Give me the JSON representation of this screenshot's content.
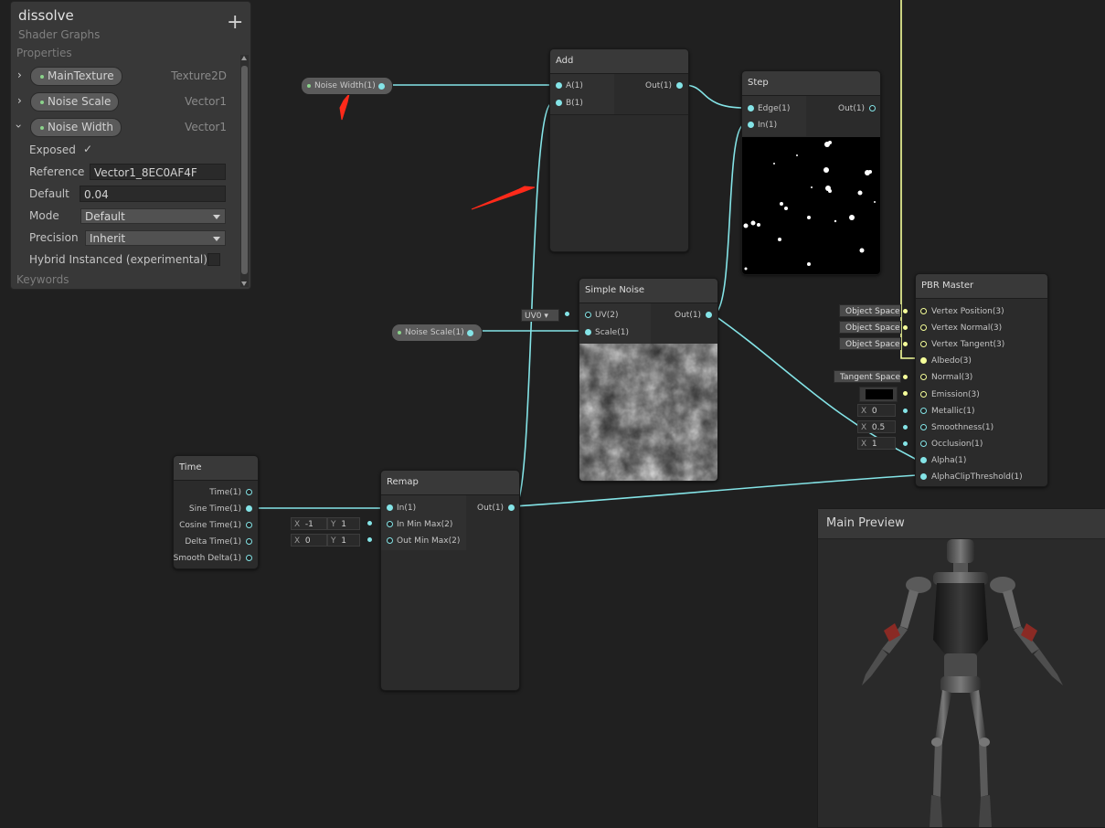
{
  "blackboard": {
    "title": "dissolve",
    "subtitle": "Shader Graphs",
    "add_label": "+",
    "properties_label": "Properties",
    "properties": [
      {
        "name": "MainTexture",
        "type": "Texture2D"
      },
      {
        "name": "Noise Scale",
        "type": "Vector1"
      },
      {
        "name": "Noise Width",
        "type": "Vector1"
      }
    ],
    "settings": {
      "exposed_label": "Exposed",
      "exposed_check": "✓",
      "reference_label": "Reference",
      "reference_value": "Vector1_8EC0AF4F",
      "default_label": "Default",
      "default_value": "0.04",
      "mode_label": "Mode",
      "mode_value": "Default",
      "precision_label": "Precision",
      "precision_value": "Inherit",
      "hybrid_label": "Hybrid Instanced (experimental)"
    },
    "keywords_label": "Keywords"
  },
  "property_nodes": {
    "noise_width": "Noise Width(1)",
    "noise_scale": "Noise Scale(1)"
  },
  "nodes": {
    "add": {
      "title": "Add",
      "in_a": "A(1)",
      "in_b": "B(1)",
      "out": "Out(1)"
    },
    "step": {
      "title": "Step",
      "edge": "Edge(1)",
      "in": "In(1)",
      "out": "Out(1)"
    },
    "simple_noise": {
      "title": "Simple Noise",
      "uv": "UV(2)",
      "scale": "Scale(1)",
      "out": "Out(1)",
      "uv_field": "UV0"
    },
    "time": {
      "title": "Time",
      "outs": [
        "Time(1)",
        "Sine Time(1)",
        "Cosine Time(1)",
        "Delta Time(1)",
        "Smooth Delta(1)"
      ]
    },
    "remap": {
      "title": "Remap",
      "in": "In(1)",
      "in_minmax": "In Min Max(2)",
      "out_minmax": "Out Min Max(2)",
      "out": "Out(1)",
      "in_x_label": "X",
      "in_x": "-1",
      "in_y_label": "Y",
      "in_y": "1",
      "out_x_label": "X",
      "out_x": "0",
      "out_y_label": "Y",
      "out_y": "1"
    },
    "pbr": {
      "title": "PBR Master",
      "inputs": [
        "Vertex Position(3)",
        "Vertex Normal(3)",
        "Vertex Tangent(3)",
        "Albedo(3)",
        "Normal(3)",
        "Emission(3)",
        "Metallic(1)",
        "Smoothness(1)",
        "Occlusion(1)",
        "Alpha(1)",
        "AlphaClipThreshold(1)"
      ],
      "space_fields": [
        "Object Space",
        "Object Space",
        "Object Space"
      ],
      "normal_field": "Tangent Space",
      "metallic_label": "X",
      "metallic": "0",
      "smoothness_label": "X",
      "smoothness": "0.5",
      "occlusion_label": "X",
      "occlusion": "1"
    }
  },
  "main_preview": {
    "title": "Main Preview"
  },
  "colors": {
    "wire": "#84e4e7",
    "wire_vec3": "#f6ff9a",
    "annotation": "#ff2a1a",
    "background": "#202020"
  }
}
